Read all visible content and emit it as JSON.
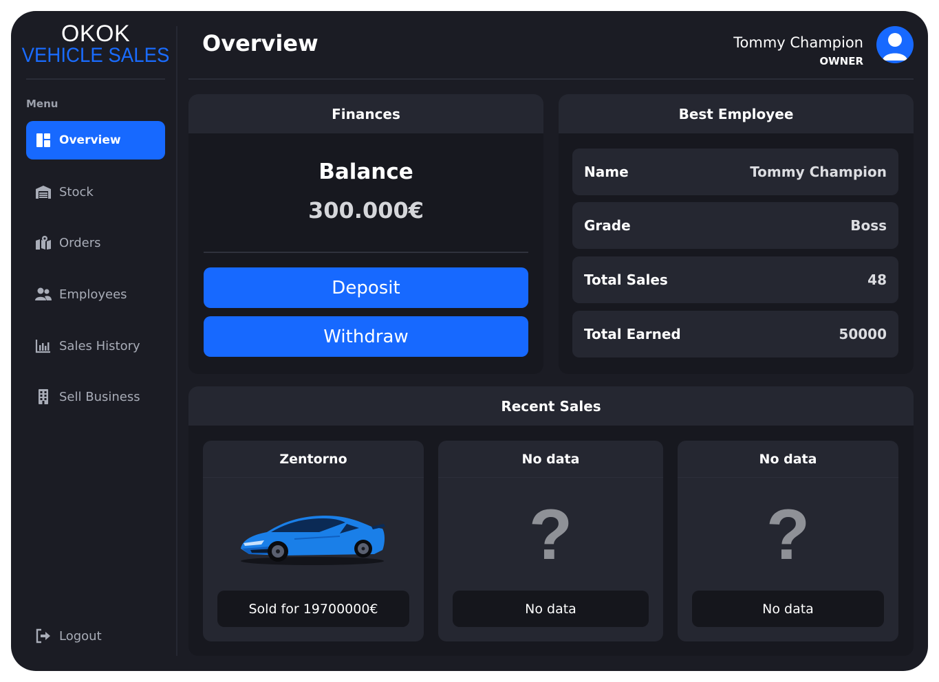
{
  "brand": {
    "line1": "OKOK",
    "line2": "VEHICLE SALES",
    "accent": "#1769ff"
  },
  "sidebar": {
    "menu_label": "Menu",
    "items": [
      {
        "label": "Overview",
        "icon": "dashboard-icon",
        "active": true
      },
      {
        "label": "Stock",
        "icon": "warehouse-icon"
      },
      {
        "label": "Orders",
        "icon": "map-location-icon"
      },
      {
        "label": "Employees",
        "icon": "users-icon"
      },
      {
        "label": "Sales History",
        "icon": "bar-chart-icon"
      },
      {
        "label": "Sell Business",
        "icon": "building-icon"
      }
    ],
    "logout": {
      "label": "Logout",
      "icon": "logout-icon"
    }
  },
  "header": {
    "title": "Overview",
    "user": {
      "name": "Tommy Champion",
      "role": "OWNER",
      "avatar_icon": "user-avatar-icon"
    }
  },
  "finances": {
    "title": "Finances",
    "balance_label": "Balance",
    "balance_value": "300.000€",
    "deposit_label": "Deposit",
    "withdraw_label": "Withdraw"
  },
  "best_employee": {
    "title": "Best Employee",
    "rows": [
      {
        "label": "Name",
        "value": "Tommy Champion"
      },
      {
        "label": "Grade",
        "value": "Boss"
      },
      {
        "label": "Total Sales",
        "value": "48"
      },
      {
        "label": "Total Earned",
        "value": "50000"
      }
    ]
  },
  "recent_sales": {
    "title": "Recent Sales",
    "items": [
      {
        "title": "Zentorno",
        "footer": "Sold for 19700000€",
        "image": "blue-sports-car"
      },
      {
        "title": "No data",
        "footer": "No data",
        "image": "question-mark-icon",
        "placeholder": "?"
      },
      {
        "title": "No data",
        "footer": "No data",
        "image": "question-mark-icon",
        "placeholder": "?"
      }
    ]
  }
}
